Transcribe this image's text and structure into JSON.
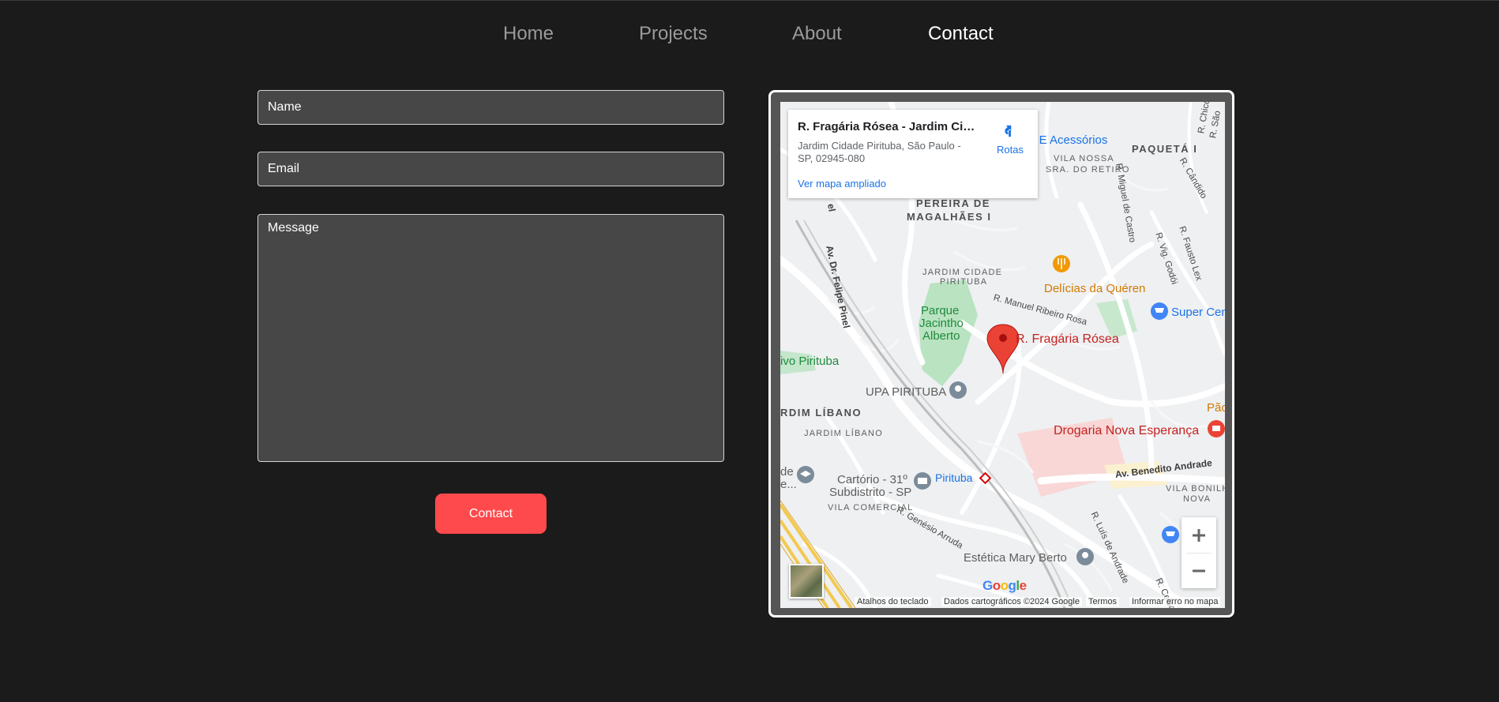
{
  "nav": {
    "items": [
      {
        "label": "Home",
        "active": false
      },
      {
        "label": "Projects",
        "active": false
      },
      {
        "label": "About",
        "active": false
      },
      {
        "label": "Contact",
        "active": true
      }
    ]
  },
  "form": {
    "name_placeholder": "Name",
    "email_placeholder": "Email",
    "message_placeholder": "Message",
    "submit_label": "Contact",
    "submit_color": "#ff4a4d"
  },
  "map": {
    "card": {
      "title": "R. Fragária Rósea - Jardim Cidade Pirituba",
      "address": "Jardim Cidade Pirituba, São Paulo - SP, 02945-080",
      "link": "Ver mapa ampliado",
      "directions": "Rotas",
      "directions_icon": "directions-icon"
    },
    "labels": {
      "pereira": "PEREIRA DE",
      "magalhaes": "MAGALHÃES I",
      "paqueta": "PAQUETÁ I",
      "vila_nossa": "VILA NOSSA",
      "sra_retiro": "SRA. DO RETIRO",
      "acessorios": "s E Acessórios",
      "jardim_cidade": "JARDIM CIDADE",
      "pirituba_small": "PIRITUBA",
      "parque1": "Parque",
      "parque2": "Jacintho",
      "parque3": "Alberto",
      "delicias": "Delícias da Quéren",
      "super": "Super Cen",
      "pin_label": "R. Fragária Rósea",
      "vivo": "ivo Pirituba",
      "upa": "UPA PIRITUBA",
      "jardim_libano_big": "RDIM LÍBANO",
      "jardim_libano": "JARDIM LÍBANO",
      "drogaria": "Drogaria Nova Esperança",
      "pae": "Pão",
      "av_benedito": "Av. Benedito Andrade",
      "vila_bonilha1": "VILA BONILH",
      "vila_bonilha2": "NOVA",
      "cartorio1": "Cartório - 31º",
      "cartorio2": "Subdistrito - SP",
      "pirituba_station": "Pirituba",
      "de1": "de",
      "de2": "e...",
      "vila_comercial": "VILA COMERCIAL",
      "estetica": "Estética Mary Berto",
      "av_felipe": "Av. Dr. Felipe Pinel",
      "r_manuel": "R. Manuel Ribeiro Rosa",
      "r_miguel": "R. Miguel de Castro",
      "r_vig": "R. Vig. Godói",
      "r_fausto": "R. Fausto Lex",
      "r_candido": "R. Cândido",
      "r_genesio": "R. Genésio Arruda",
      "r_luis": "R. Luís de Andrade",
      "r_celso": "R. Celso",
      "r_chico": "R. Chico",
      "r_sao": "R. São",
      "el": "el"
    },
    "attribution": {
      "shortcuts": "Atalhos do teclado",
      "data": "Dados cartográficos ©2024 Google",
      "terms": "Termos",
      "report": "Informar erro no mapa"
    },
    "google": [
      "G",
      "o",
      "o",
      "g",
      "l",
      "e"
    ],
    "pin_color": "#ea4335"
  }
}
